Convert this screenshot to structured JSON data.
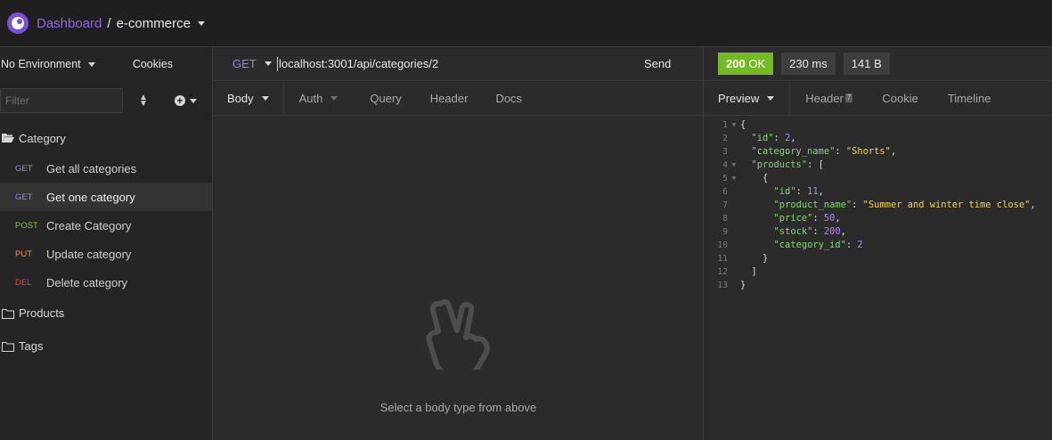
{
  "header": {
    "breadcrumb_home": "Dashboard",
    "breadcrumb_sep": "/",
    "breadcrumb_current": "e-commerce"
  },
  "sidebar": {
    "environment_label": "No Environment",
    "cookies_label": "Cookies",
    "filter_placeholder": "Filter",
    "folders": [
      {
        "name": "Category",
        "open": true,
        "requests": [
          {
            "method": "GET",
            "name": "Get all categories",
            "active": false
          },
          {
            "method": "GET",
            "name": "Get one category",
            "active": true
          },
          {
            "method": "POST",
            "name": "Create Category",
            "active": false
          },
          {
            "method": "PUT",
            "name": "Update category",
            "active": false
          },
          {
            "method": "DEL",
            "name": "Delete category",
            "active": false
          }
        ]
      },
      {
        "name": "Products",
        "open": false
      },
      {
        "name": "Tags",
        "open": false
      }
    ]
  },
  "request": {
    "method": "GET",
    "url": "localhost:3001/api/categories/2",
    "send_label": "Send",
    "tabs": [
      "Body",
      "Auth",
      "Query",
      "Header",
      "Docs"
    ],
    "active_tab": "Body",
    "empty_state_text": "Select a body type from above"
  },
  "response": {
    "status": "200",
    "status_text": "OK",
    "time": "230 ms",
    "size": "141 B",
    "tabs": [
      "Preview",
      "Header",
      "Cookie",
      "Timeline"
    ],
    "header_count": "7",
    "active_tab": "Preview",
    "body_lines": [
      "{",
      "  \"id\": 2,",
      "  \"category_name\": \"Shorts\",",
      "  \"products\": [",
      "    {",
      "      \"id\": 11,",
      "      \"product_name\": \"Summer and winter time close\",",
      "      \"price\": 50,",
      "      \"stock\": 200,",
      "      \"category_id\": 2",
      "    }",
      "  ]",
      "}"
    ],
    "foldable_lines": [
      1,
      4,
      5
    ]
  },
  "colors": {
    "accent": "#7c4dd8",
    "get": "#9b82e8",
    "post": "#7cc243",
    "put": "#f0903a",
    "del": "#e24a3a",
    "status_ok": "#75ba24"
  },
  "icons": {
    "logo": "insomnia-logo-icon",
    "folder_open": "folder-open-icon",
    "folder": "folder-icon",
    "empty_state": "peace-hand-icon"
  }
}
